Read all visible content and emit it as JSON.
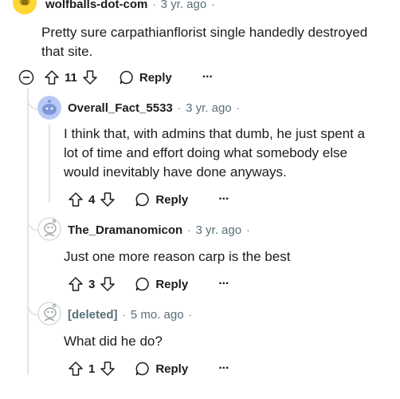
{
  "comments": [
    {
      "username": "wolfballs-dot-com",
      "separator": "·",
      "age": "3 yr. ago",
      "trail": "·",
      "body": "Pretty sure carpathianflorist single handedly destroyed that site.",
      "votes": "11",
      "reply_label": "Reply",
      "more_label": "···"
    },
    {
      "username": "Overall_Fact_5533",
      "separator": "·",
      "age": "3 yr. ago",
      "trail": "·",
      "body": "I think that, with admins that dumb, he just spent a lot of time and effort doing what somebody else would inevitably have done anyways.",
      "votes": "4",
      "reply_label": "Reply",
      "more_label": "···"
    },
    {
      "username": "The_Dramanomicon",
      "separator": "·",
      "age": "3 yr. ago",
      "trail": "·",
      "body": "Just one more reason carp is the best",
      "votes": "3",
      "reply_label": "Reply",
      "more_label": "···"
    },
    {
      "username": "[deleted]",
      "separator": "·",
      "age": "5 mo. ago",
      "trail": "·",
      "body": "What did he do?",
      "votes": "1",
      "reply_label": "Reply",
      "more_label": "···"
    }
  ],
  "colors": {
    "meta_gray": "#576f76",
    "thread_line": "#e5e5e5",
    "avatar_yellow": "#ffd635",
    "avatar_blue": "#b7c9f5"
  },
  "icons": [
    "collapse-icon",
    "upvote-icon",
    "downvote-icon",
    "comment-bubble-icon",
    "more-icon",
    "snoo-avatar-icon"
  ]
}
